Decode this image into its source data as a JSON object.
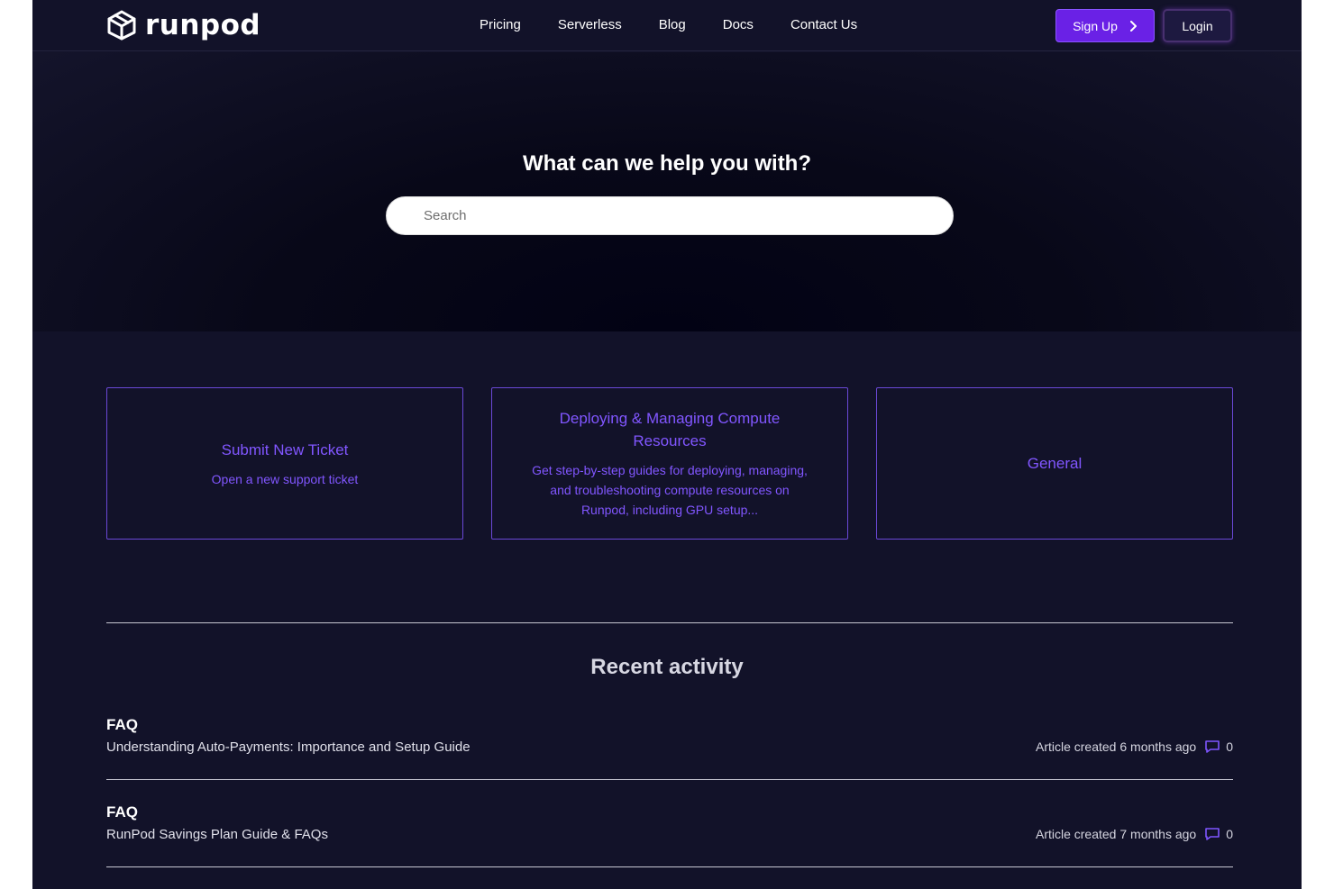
{
  "brand": {
    "name": "runpod"
  },
  "nav": {
    "links": [
      {
        "label": "Pricing"
      },
      {
        "label": "Serverless"
      },
      {
        "label": "Blog"
      },
      {
        "label": "Docs"
      },
      {
        "label": "Contact Us"
      }
    ],
    "signup_label": "Sign Up",
    "login_label": "Login"
  },
  "hero": {
    "title": "What can we help you with?",
    "search_placeholder": "Search"
  },
  "cards": [
    {
      "title": "Submit New Ticket",
      "description": "Open a new support ticket"
    },
    {
      "title": "Deploying & Managing Compute Resources",
      "description": "Get step-by-step guides for deploying, managing, and troubleshooting compute resources on Runpod, including GPU setup..."
    },
    {
      "title": "General",
      "description": ""
    }
  ],
  "recent": {
    "title": "Recent activity",
    "items": [
      {
        "category": "FAQ",
        "title": "Understanding Auto-Payments: Importance and Setup Guide",
        "meta": "Article created 6 months ago",
        "comments": "0"
      },
      {
        "category": "FAQ",
        "title": "RunPod Savings Plan Guide & FAQs",
        "meta": "Article created 7 months ago",
        "comments": "0"
      }
    ]
  },
  "colors": {
    "page_bg": "#121229",
    "accent_purple": "#6a21e6",
    "card_text": "#8156ff",
    "card_border": "#6a48d6"
  },
  "icons": {
    "logo": "runpod-cube-logo-icon",
    "signup_chevron": "chevron-right-icon",
    "comment": "comment-bubble-icon",
    "search": "search-icon"
  }
}
